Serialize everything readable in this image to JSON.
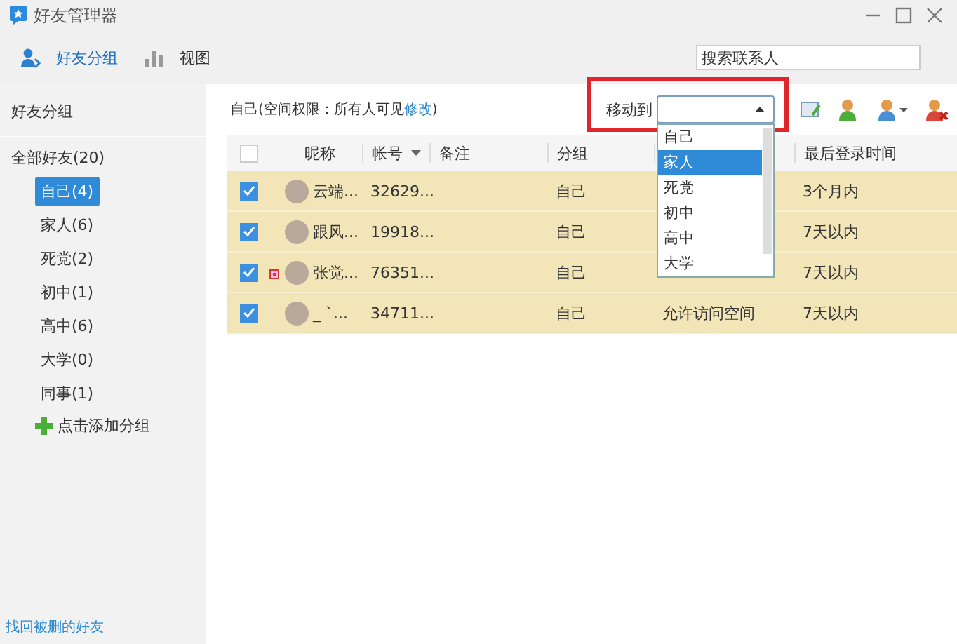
{
  "window": {
    "title": "好友管理器"
  },
  "toolbar": {
    "tabs": [
      {
        "label": "好友分组",
        "kind": "people",
        "selected": true
      },
      {
        "label": "视图",
        "kind": "chart",
        "selected": false
      }
    ]
  },
  "search": {
    "placeholder": "搜索联系人"
  },
  "sidebar": {
    "heading": "好友分组",
    "all_label": "全部好友(20)",
    "groups": [
      {
        "label": "自己(4)",
        "selected": true
      },
      {
        "label": "家人(6)",
        "selected": false
      },
      {
        "label": "死党(2)",
        "selected": false
      },
      {
        "label": "初中(1)",
        "selected": false
      },
      {
        "label": "高中(6)",
        "selected": false
      },
      {
        "label": "大学(0)",
        "selected": false
      },
      {
        "label": "同事(1)",
        "selected": false
      }
    ],
    "add_label": "点击添加分组",
    "recover_link": "找回被删的好友"
  },
  "group_info": {
    "text": "自己(空间权限：所有人可见",
    "link": "修改",
    "tail": ")"
  },
  "move_to": {
    "label": "移动到",
    "expanded": true,
    "options": [
      {
        "label": "自己",
        "selected": false
      },
      {
        "label": "家人",
        "selected": true
      },
      {
        "label": "死党",
        "selected": false
      },
      {
        "label": "初中",
        "selected": false
      },
      {
        "label": "高中",
        "selected": false
      },
      {
        "label": "大学",
        "selected": false
      }
    ]
  },
  "table": {
    "all_checked": false,
    "columns": [
      {
        "label": "昵称",
        "sorted": false
      },
      {
        "label": "帐号",
        "sorted": true
      },
      {
        "label": "备注",
        "sorted": false
      },
      {
        "label": "分组",
        "sorted": false
      },
      {
        "label": "最后登录时间",
        "sorted": false
      }
    ],
    "rows": [
      {
        "checked": true,
        "flagged": false,
        "nickname": "云端...",
        "account": "32629...",
        "group": "自己",
        "last_login": "3个月内"
      },
      {
        "checked": true,
        "flagged": false,
        "nickname": "跟风...",
        "account": "19918...",
        "group": "自己",
        "last_login": "7天以内"
      },
      {
        "checked": true,
        "flagged": true,
        "nickname": "张觉...",
        "account": "76351...",
        "group": "自己",
        "last_login": "7天以内"
      },
      {
        "checked": true,
        "flagged": false,
        "nickname": "_ `...",
        "account": "34711...",
        "group": "自己",
        "space": "允许访问空间",
        "last_login": "7天以内"
      }
    ]
  }
}
